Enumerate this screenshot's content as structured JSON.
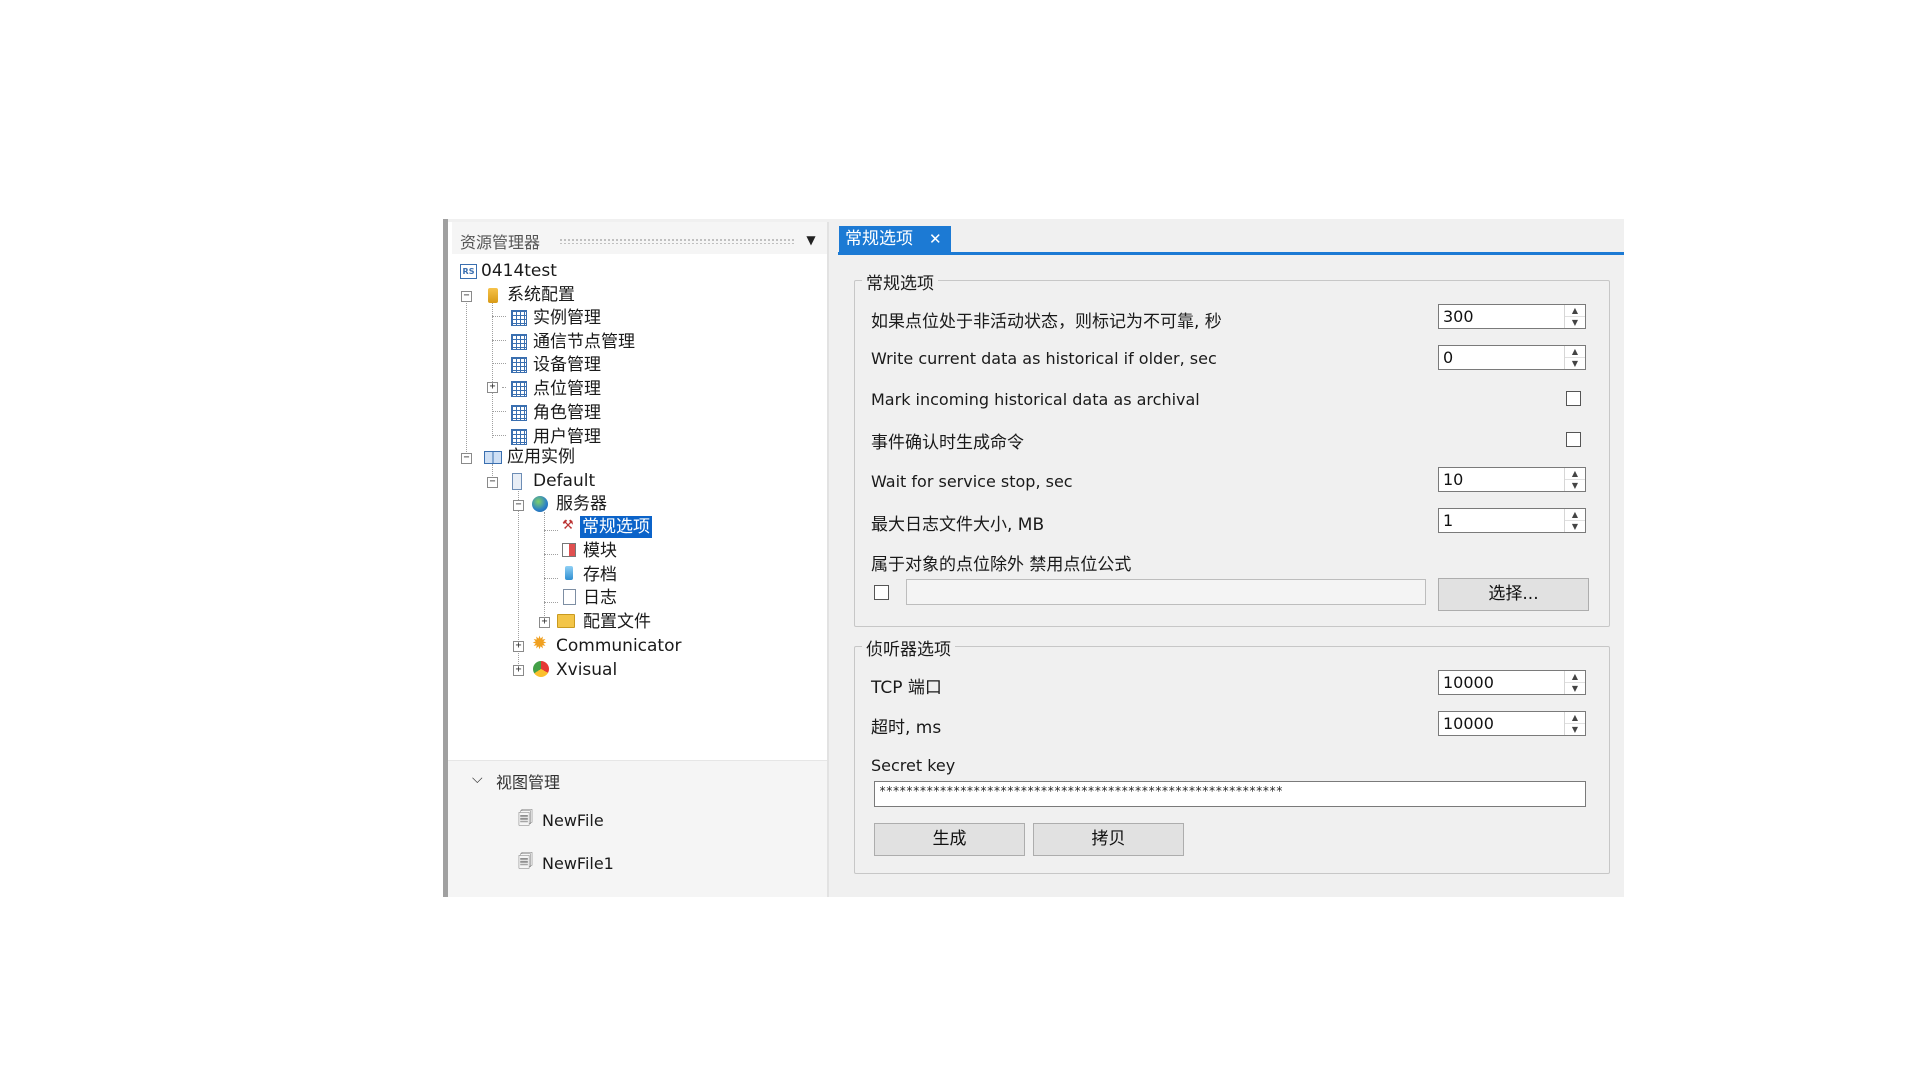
{
  "explorer": {
    "title": "资源管理器",
    "tree": {
      "root": "0414test",
      "root_badge": "RS",
      "system_config": "系统配置",
      "instance_mgmt": "实例管理",
      "comm_node_mgmt": "通信节点管理",
      "device_mgmt": "设备管理",
      "point_mgmt": "点位管理",
      "role_mgmt": "角色管理",
      "user_mgmt": "用户管理",
      "app_instance": "应用实例",
      "default": "Default",
      "server": "服务器",
      "general_options": "常规选项",
      "modules": "模块",
      "archive": "存档",
      "log": "日志",
      "config_files": "配置文件",
      "communicator": "Communicator",
      "xvisual": "Xvisual"
    },
    "view_section": {
      "title": "视图管理",
      "items": [
        "NewFile",
        "NewFile1"
      ]
    }
  },
  "tab": {
    "label": "常规选项",
    "close": "✕"
  },
  "general": {
    "legend": "常规选项",
    "inactive_label": "如果点位处于非活动状态，则标记为不可靠, 秒",
    "inactive_value": "300",
    "write_hist_label": "Write current data as historical if older, sec",
    "write_hist_value": "0",
    "mark_archival_label": "Mark incoming historical data as archival",
    "event_ack_label": "事件确认时生成命令",
    "wait_stop_label": "Wait for service stop, sec",
    "wait_stop_value": "10",
    "max_log_label": "最大日志文件大小, MB",
    "max_log_value": "1",
    "disable_formula_label": "属于对象的点位除外 禁用点位公式",
    "select_button": "选择..."
  },
  "listener": {
    "legend": "侦听器选项",
    "tcp_label": "TCP 端口",
    "tcp_value": "10000",
    "timeout_label": "超时, ms",
    "timeout_value": "10000",
    "secret_label": "Secret key",
    "secret_value": "************************************************************",
    "generate_button": "生成",
    "copy_button": "拷贝"
  },
  "colors": {
    "accent": "#1c7ad4",
    "selection": "#0b63c9"
  }
}
